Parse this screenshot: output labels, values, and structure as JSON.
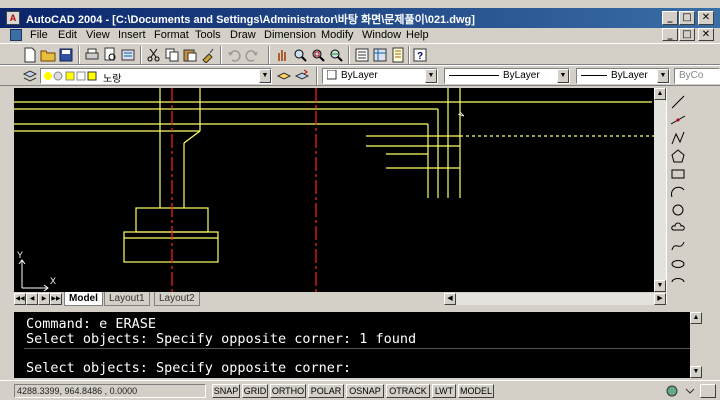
{
  "window": {
    "title": "AutoCAD 2004 - [C:\\Documents and Settings\\Administrator\\바탕 화면\\문제풀이\\021.dwg]",
    "app_icon_text": "A",
    "minimize": "_",
    "restore": "□",
    "close": "✕"
  },
  "menu": {
    "items": [
      "File",
      "Edit",
      "View",
      "Insert",
      "Format",
      "Tools",
      "Draw",
      "Dimension",
      "Modify",
      "Window",
      "Help"
    ]
  },
  "layer_toolbar": {
    "layer_name": "노랑",
    "color_value": "ByLayer",
    "linetype_value": "ByLayer",
    "lineweight_value": "ByLayer",
    "plotstyle_value": "ByCo"
  },
  "tabs": {
    "model": "Model",
    "layout1": "Layout1",
    "layout2": "Layout2"
  },
  "command": {
    "line1": "Command: e ERASE",
    "line2": "Select objects: Specify opposite corner: 1 found",
    "line3": "Select objects: Specify opposite corner:"
  },
  "status": {
    "coordinates": "4288.3399, 964.8486 , 0.0000",
    "toggles": [
      "SNAP",
      "GRID",
      "ORTHO",
      "POLAR",
      "OSNAP",
      "OTRACK",
      "LWT",
      "MODEL"
    ]
  },
  "ucs": {
    "x_label": "X",
    "y_label": "Y"
  },
  "colors": {
    "canvas_bg": "#000000",
    "drawing_yellow": "#ffff66",
    "centerline_red": "#ff2020",
    "titlebar_start": "#0a246a",
    "titlebar_end": "#3a6ea5"
  },
  "icons": {
    "standard_toolbar": [
      "new-icon",
      "open-icon",
      "save-icon",
      "plot-icon",
      "preview-icon",
      "publish-icon",
      "cut-icon",
      "copy-icon",
      "paste-icon",
      "match-properties-icon",
      "undo-icon",
      "redo-icon",
      "pan-icon",
      "zoom-realtime-icon",
      "zoom-window-icon",
      "zoom-previous-icon",
      "properties-icon",
      "design-center-icon",
      "tool-palettes-icon",
      "help-icon"
    ],
    "draw_toolbar": [
      "line-icon",
      "construction-line-icon",
      "polyline-icon",
      "polygon-icon",
      "rectangle-icon",
      "arc-icon",
      "circle-icon",
      "revision-cloud-icon",
      "spline-icon",
      "ellipse-icon",
      "ellipse-arc-icon",
      "insert-block-icon",
      "make-block-icon",
      "point-icon",
      "hatch-icon",
      "region-icon",
      "table-icon",
      "mtext-icon"
    ]
  }
}
